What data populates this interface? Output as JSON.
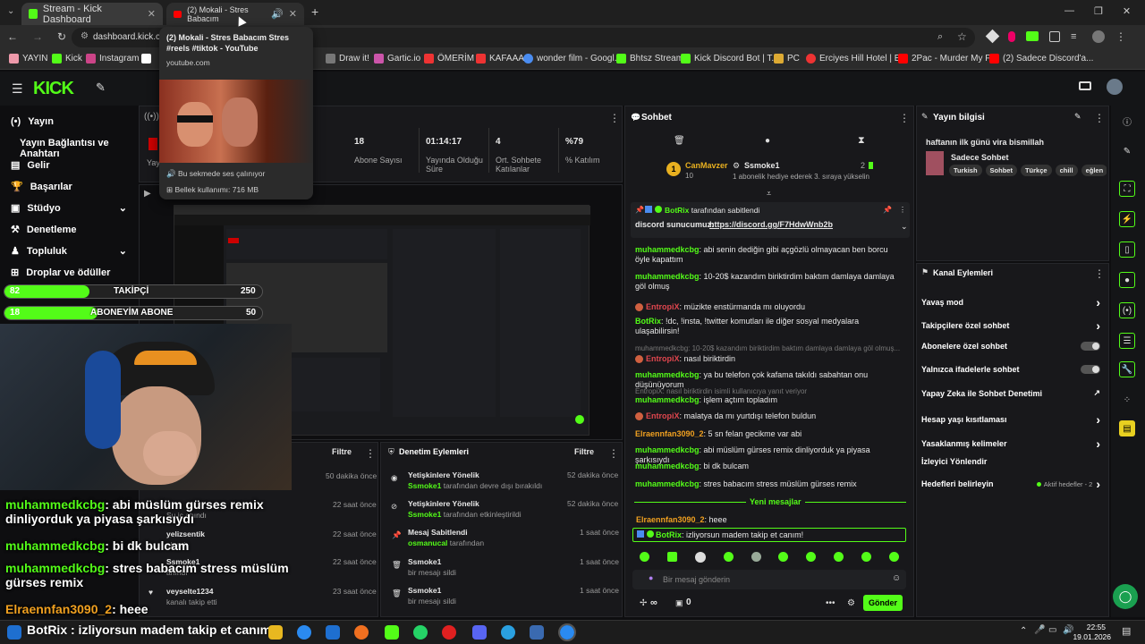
{
  "browser": {
    "tabs": [
      {
        "title": "Stream - Kick Dashboard"
      },
      {
        "title": "(2) Mokali - Stres Babacım"
      }
    ],
    "url": "dashboard.kick.co",
    "tooltip": {
      "title": "(2) Mokali - Stres Babacım Stres #reels #tiktok - YouTube",
      "domain": "youtube.com",
      "audio": "Bu sekmede ses çalınıyor",
      "memory": "Bellek kullanımı: 716 MB"
    },
    "bookmarks": [
      "YAYIN",
      "Kick",
      "Instagram",
      "Draw it!",
      "Gartic.io",
      "ÖMERİM",
      "KAFAAA",
      "wonder film - Googl...",
      "Bhtsz Stream",
      "Kick Discord Bot | T...",
      "PC",
      "Erciyes Hill Hotel | E...",
      "2Pac - Murder My F...",
      "(2) Sadece Discord'a..."
    ]
  },
  "sidebar": {
    "items": [
      {
        "label": "Yayın"
      },
      {
        "label": "Yayın Bağlantısı ve Anahtarı"
      },
      {
        "label": "Gelir"
      },
      {
        "label": "Başarılar"
      },
      {
        "label": "Stüdyo"
      },
      {
        "label": "Denetleme"
      },
      {
        "label": "Topluluk"
      },
      {
        "label": "Droplar ve ödüller"
      }
    ]
  },
  "overlay": {
    "follower_goal": {
      "current": "82",
      "label": "TAKİPÇİ",
      "target": "250",
      "progress": 0.33
    },
    "sub_goal": {
      "current": "18",
      "label": "ABONEYİM ABONE",
      "target": "50",
      "progress": 0.36
    },
    "chat": [
      {
        "user": "muhammedkcbg",
        "text": ": abi müslüm gürses remix dinliyorduk ya piyasa şarkısıydı"
      },
      {
        "user": "muhammedkcbg",
        "text": ": bi dk bulcam"
      },
      {
        "user": "muhammedkcbg",
        "text": ": stres babacım stress müslüm gürses remix"
      },
      {
        "user": "Elraennfan3090_2",
        "text": ": heee"
      }
    ],
    "botrix_banner": "BotRix : izliyorsun madem takip et canım!"
  },
  "stats": [
    {
      "value": "18",
      "label": "Abone Sayısı"
    },
    {
      "value": "01:14:17",
      "label": "Yayında Olduğu Süre"
    },
    {
      "value": "4",
      "label": "Ort. Sohbete Katılanlar"
    },
    {
      "value": "%79",
      "label": "% Katılım"
    }
  ],
  "stats_left_label": "Yay",
  "activity": {
    "filter_label": "Filtre",
    "items": [
      {
        "time": "50 dakika önce"
      },
      {
        "time": "22 saat önce",
        "sub": "Su iç ahındı"
      },
      {
        "time": "22 saat önce",
        "user": "yelizsentik",
        "sub": "ahındı"
      },
      {
        "time": "22 saat önce",
        "user": "Ssmoke1",
        "sub": "ahındı"
      },
      {
        "time": "23 saat önce",
        "user": "veyselte1234",
        "sub": "kanalı takip etti"
      }
    ]
  },
  "mod_actions": {
    "title": "Denetim Eylemleri",
    "filter_label": "Filtre",
    "items": [
      {
        "title": "Yetişkinlere Yönelik",
        "user": "Ssmoke1",
        "sub": " tarafından devre dışı bırakıldı",
        "time": "52 dakika önce"
      },
      {
        "title": "Yetişkinlere Yönelik",
        "user": "Ssmoke1",
        "sub": " tarafından etkinleştirildi",
        "time": "52 dakika önce"
      },
      {
        "title": "Mesaj Sabitlendi",
        "user": "osmanucal",
        "sub": " tarafından",
        "time": "1 saat önce"
      },
      {
        "title": "Ssmoke1",
        "user": "",
        "sub": "bir mesajı sildi",
        "time": "1 saat önce"
      },
      {
        "title": "Ssmoke1",
        "user": "",
        "sub": "bir mesajı sildi",
        "time": "1 saat önce"
      }
    ]
  },
  "chat": {
    "title": "Sohbet",
    "gifter": {
      "name": "CanMavzer",
      "count": "10",
      "recipient": "Ssmoke1",
      "recipient_count": "2",
      "note": "1 abonelik hediye ederek 3. sıraya yükselin"
    },
    "pinned": {
      "by": "BotRix",
      "by_suffix": " tarafından sabitlendi",
      "text": "discord sunucumuz: ",
      "link": "https://discord.gg/F7HdwWnb2b"
    },
    "messages": [
      {
        "user": "muhammedkcbg",
        "text": ": abi senin dediğin gibi açgözlü olmayacan ben borcu öyle kapattım",
        "color": "#53fc18"
      },
      {
        "user": "muhammedkcbg",
        "text": ": 10-20$ kazandım biriktirdim baktım damlaya damlaya göl olmuş",
        "color": "#53fc18"
      },
      {
        "user": "EntropiX",
        "text": ": müzikte enstürmanda mı oluyordu",
        "color": "#e0464e"
      },
      {
        "user": "BotRix",
        "text": ": !dc, !insta, !twitter komutları ile diğer sosyal medyalara ulaşabilirsin!",
        "color": "#53fc18"
      },
      {
        "user": "",
        "text": "muhammedkcbg: 10-20$ kazandım biriktirdim baktım damlaya damlaya göl olmuş...",
        "color": "#777"
      },
      {
        "user": "EntropiX",
        "text": ": nasıl biriktirdin",
        "color": "#e0464e"
      },
      {
        "user": "muhammedkcbg",
        "text": ": ya bu telefon çok kafama takıldı sabahtan onu düşünüyorum",
        "color": "#53fc18"
      },
      {
        "user": "",
        "text": "EntropiX: nasıl biriktirdin isimli kullanıcıya yanıt veriyor",
        "color": "#777"
      },
      {
        "user": "muhammedkcbg",
        "text": ": işlem açtım topladım",
        "color": "#53fc18"
      },
      {
        "user": "EntropiX",
        "text": ": malatya da mı yurtdışı telefon buldun",
        "color": "#e0464e"
      },
      {
        "user": "Elraennfan3090_2",
        "text": ": 5 sn felan gecikme var abi",
        "color": "#f0a020"
      },
      {
        "user": "muhammedkcbg",
        "text": ": abi müslüm gürses remix dinliyorduk ya piyasa şarkısıydı",
        "color": "#53fc18"
      },
      {
        "user": "muhammedkcbg",
        "text": ": bi dk bulcam",
        "color": "#53fc18"
      },
      {
        "user": "muhammedkcbg",
        "text": ": stres babacım stress müslüm gürses remix",
        "color": "#53fc18"
      }
    ],
    "new_messages": "Yeni mesajlar",
    "after": [
      {
        "user": "Elraennfan3090_2",
        "text": ": heee",
        "color": "#f0a020"
      },
      {
        "user": "BotRix",
        "text": ": izliyorsun madem takip et canım!",
        "color": "#53fc18"
      }
    ],
    "input_placeholder": "Bir mesaj gönderin",
    "send_label": "Gönder",
    "points": "∞",
    "points2": "0"
  },
  "stream_info": {
    "title": "Yayın bilgisi",
    "stream_title": "haftanın ilk günü vira bismillah",
    "category": "Sadece Sohbet",
    "tags": [
      "Turkish",
      "Sohbet",
      "Türkçe",
      "chill",
      "eğlen"
    ]
  },
  "channel_actions": {
    "title": "Kanal Eylemleri",
    "items": [
      {
        "label": "Yavaş mod",
        "control": "arrow"
      },
      {
        "label": "Takipçilere özel sohbet",
        "control": "arrow"
      },
      {
        "label": "Abonelere özel sohbet",
        "control": "toggle"
      },
      {
        "label": "Yalnızca ifadelerle sohbet",
        "control": "toggle"
      },
      {
        "label": "Yapay Zeka ile Sohbet Denetimi",
        "control": "external"
      },
      {
        "label": "Hesap yaşı kısıtlaması",
        "control": "arrow"
      },
      {
        "label": "Yasaklanmış kelimeler",
        "control": "arrow"
      },
      {
        "label": "İzleyici Yönlendir",
        "control": "none"
      },
      {
        "label": "Hedefleri belirleyin",
        "control": "arrow",
        "extra": "Aktif hedefler - 2"
      }
    ]
  },
  "taskbar": {
    "time": "22:55",
    "date": "19.01.2026"
  },
  "colors": {
    "accent": "#53fc18",
    "bg": "#0e0e10",
    "panel": "#18181b"
  }
}
